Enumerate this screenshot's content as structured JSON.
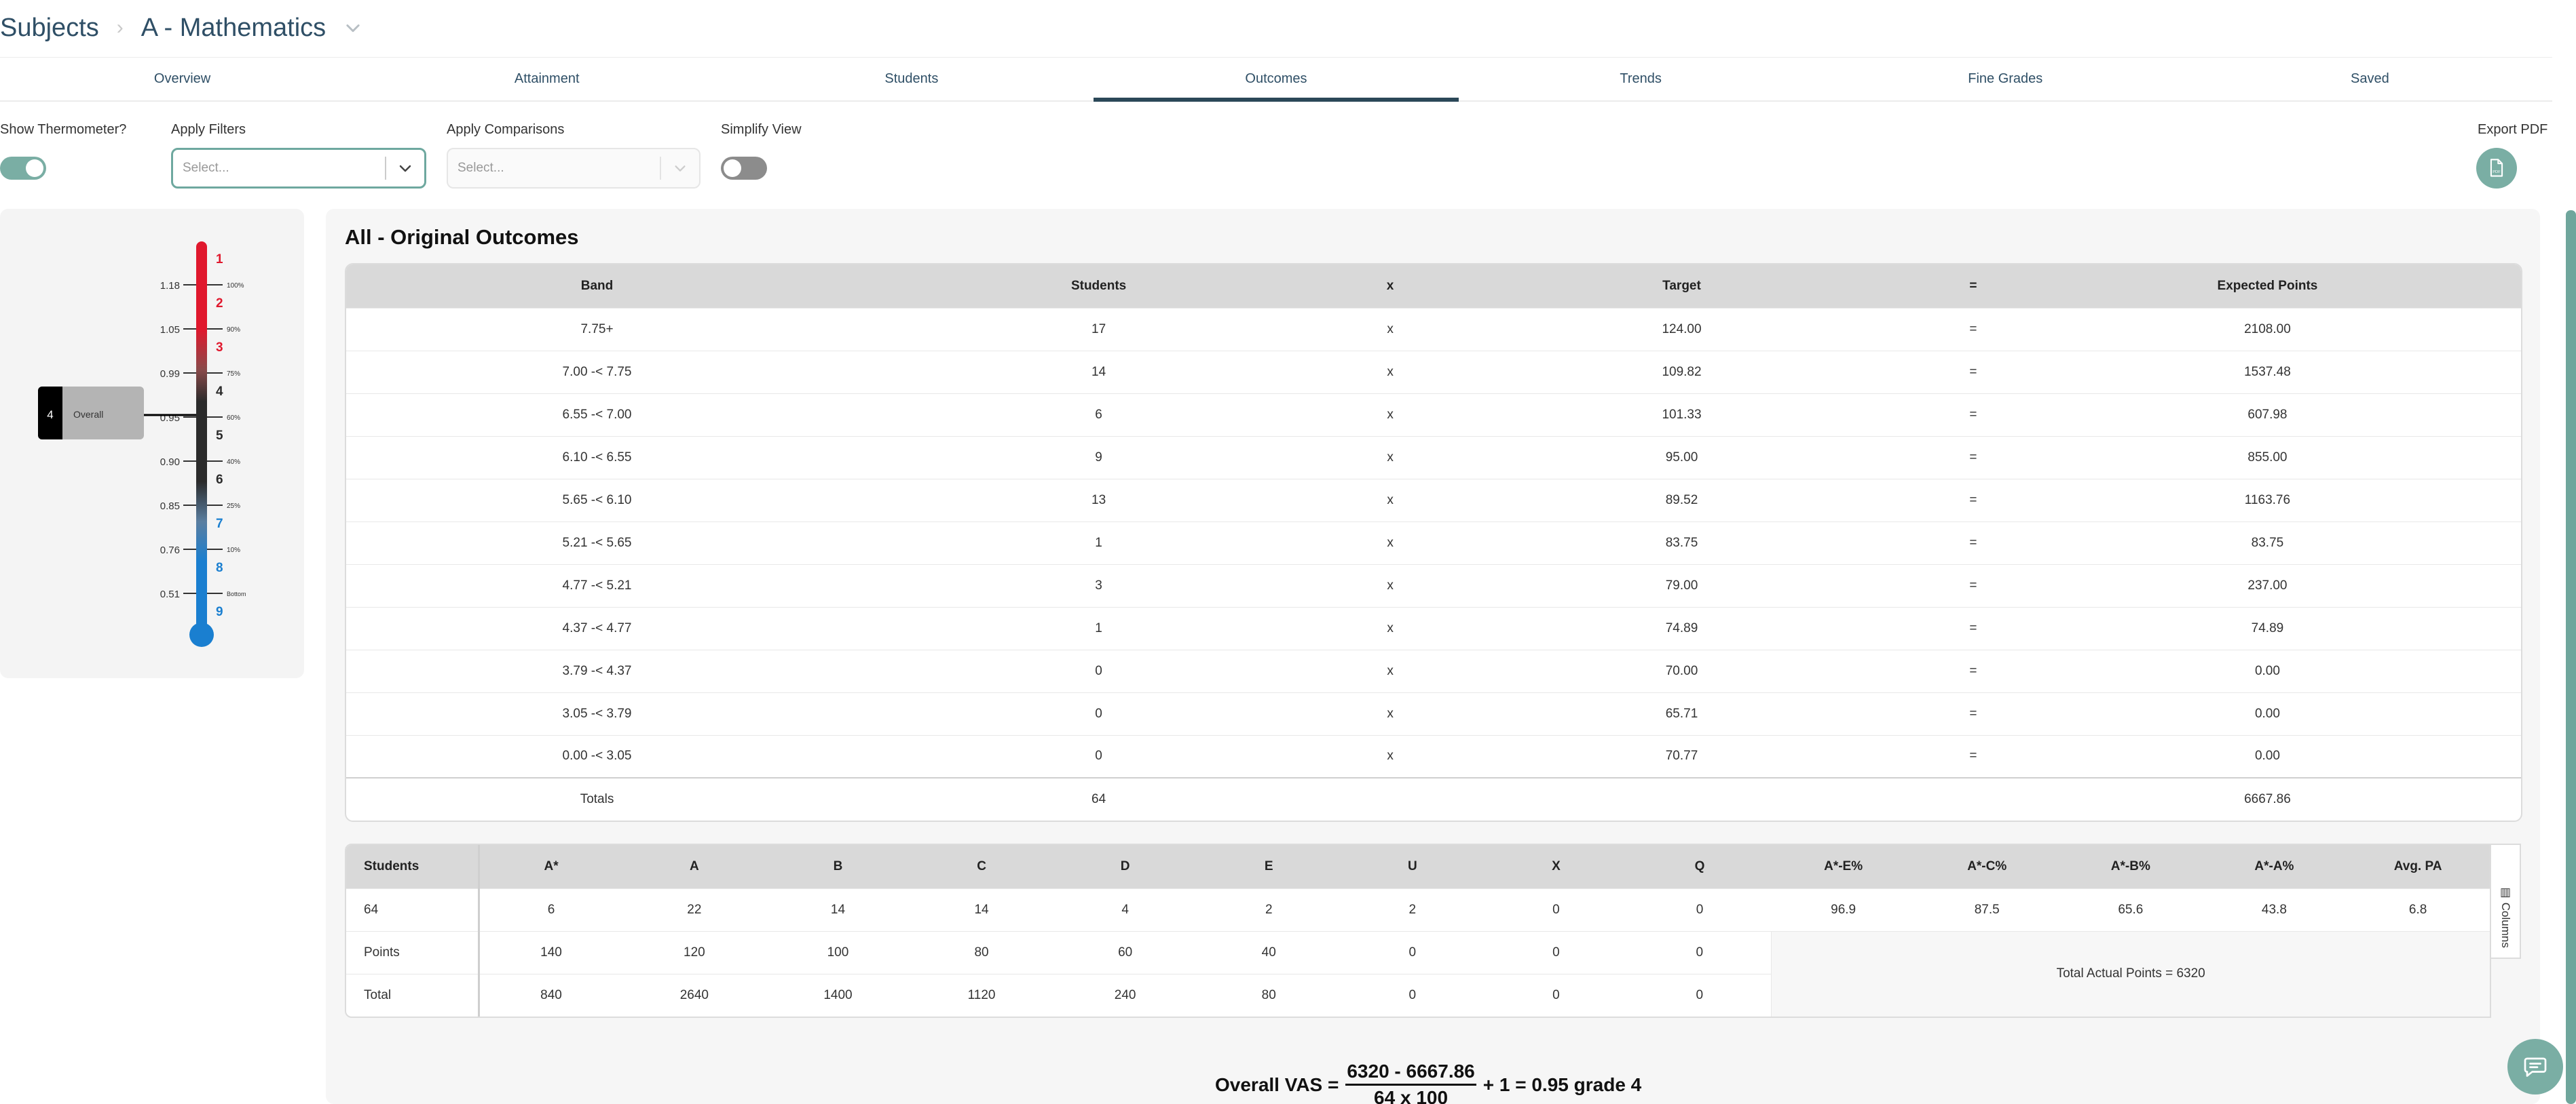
{
  "breadcrumb": {
    "root": "Subjects",
    "current": "A - Mathematics"
  },
  "tabs": [
    "Overview",
    "Attainment",
    "Students",
    "Outcomes",
    "Trends",
    "Fine Grades",
    "Saved"
  ],
  "active_tab": "Outcomes",
  "controls": {
    "show_thermometer_label": "Show Thermometer?",
    "apply_filters_label": "Apply Filters",
    "apply_filters_placeholder": "Select...",
    "apply_comparisons_label": "Apply Comparisons",
    "apply_comparisons_placeholder": "Select...",
    "simplify_view_label": "Simplify View",
    "export_pdf_label": "Export PDF"
  },
  "thermometer": {
    "grades": [
      "1",
      "2",
      "3",
      "4",
      "5",
      "6",
      "7",
      "8",
      "9"
    ],
    "values": [
      "1.18",
      "1.05",
      "0.99",
      "0.95",
      "0.90",
      "0.85",
      "0.76",
      "0.51"
    ],
    "percents": [
      "100%",
      "90%",
      "75%",
      "60%",
      "40%",
      "25%",
      "10%",
      "Bottom"
    ],
    "marker_grade": "4",
    "marker_label": "Overall",
    "colors": {
      "red": "#e0182d",
      "dark": "#2b2b2b",
      "blue": "#1a7fd0"
    }
  },
  "outcomes": {
    "title": "All - Original Outcomes",
    "headers": [
      "Band",
      "Students",
      "x",
      "Target",
      "=",
      "Expected Points"
    ],
    "rows": [
      [
        "7.75+",
        "17",
        "x",
        "124.00",
        "=",
        "2108.00"
      ],
      [
        "7.00 -< 7.75",
        "14",
        "x",
        "109.82",
        "=",
        "1537.48"
      ],
      [
        "6.55 -< 7.00",
        "6",
        "x",
        "101.33",
        "=",
        "607.98"
      ],
      [
        "6.10 -< 6.55",
        "9",
        "x",
        "95.00",
        "=",
        "855.00"
      ],
      [
        "5.65 -< 6.10",
        "13",
        "x",
        "89.52",
        "=",
        "1163.76"
      ],
      [
        "5.21 -< 5.65",
        "1",
        "x",
        "83.75",
        "=",
        "83.75"
      ],
      [
        "4.77 -< 5.21",
        "3",
        "x",
        "79.00",
        "=",
        "237.00"
      ],
      [
        "4.37 -< 4.77",
        "1",
        "x",
        "74.89",
        "=",
        "74.89"
      ],
      [
        "3.79 -< 4.37",
        "0",
        "x",
        "70.00",
        "=",
        "0.00"
      ],
      [
        "3.05 -< 3.79",
        "0",
        "x",
        "65.71",
        "=",
        "0.00"
      ],
      [
        "0.00 -< 3.05",
        "0",
        "x",
        "70.77",
        "=",
        "0.00"
      ]
    ],
    "totals": {
      "label": "Totals",
      "students": "64",
      "expected": "6667.86"
    }
  },
  "grades": {
    "headers": [
      "Students",
      "A*",
      "A",
      "B",
      "C",
      "D",
      "E",
      "U",
      "X",
      "Q",
      "A*-E%",
      "A*-C%",
      "A*-B%",
      "A*-A%",
      "Avg. PA"
    ],
    "count_row": [
      "64",
      "6",
      "22",
      "14",
      "14",
      "4",
      "2",
      "2",
      "0",
      "0",
      "96.9",
      "87.5",
      "65.6",
      "43.8",
      "6.8"
    ],
    "points_row": [
      "Points",
      "140",
      "120",
      "100",
      "80",
      "60",
      "40",
      "0",
      "0",
      "0"
    ],
    "total_row": [
      "Total",
      "840",
      "2640",
      "1400",
      "1120",
      "240",
      "80",
      "0",
      "0",
      "0"
    ],
    "total_actual_points": "Total Actual Points = 6320",
    "columns_label": "Columns"
  },
  "formula": {
    "prefix": "Overall VAS =",
    "numerator": "6320 - 6667.86",
    "denominator": "64 x 100",
    "suffix": "+ 1 = 0.95 grade 4"
  }
}
